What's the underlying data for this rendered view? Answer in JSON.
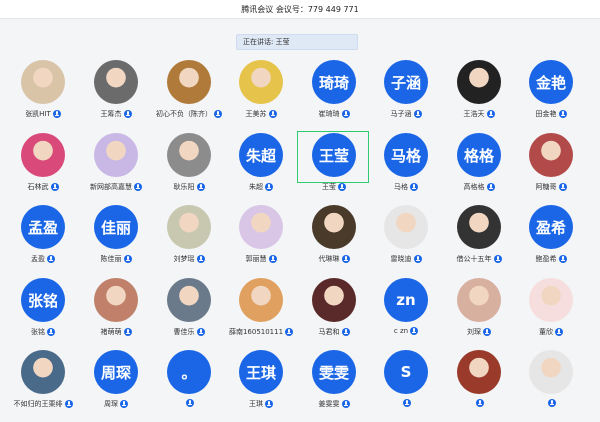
{
  "title": "腾讯会议 会议号：779 449 771",
  "speaking": "正在讲话: 王莹",
  "participants": [
    {
      "name": "张凯HIT",
      "avatar": "photo",
      "avatar_color": "#d9c4a8"
    },
    {
      "name": "王筹杰",
      "avatar": "photo",
      "avatar_color": "#6b6b6b"
    },
    {
      "name": "初心不负（陈齐）",
      "avatar": "photo",
      "avatar_color": "#b07a3b"
    },
    {
      "name": "王美苏",
      "avatar": "photo",
      "avatar_color": "#e6c34a"
    },
    {
      "name": "崔琦琦",
      "avatar": "text",
      "text": "琦琦",
      "avatar_color": "#1a66e6"
    },
    {
      "name": "马子涵",
      "avatar": "text",
      "text": "子涵",
      "avatar_color": "#1a66e6"
    },
    {
      "name": "王浩天",
      "avatar": "photo",
      "avatar_color": "#222222"
    },
    {
      "name": "田金艳",
      "avatar": "text",
      "text": "金艳",
      "avatar_color": "#1a66e6"
    },
    {
      "name": "石林武",
      "avatar": "photo",
      "avatar_color": "#d94a7a"
    },
    {
      "name": "新网部高嘉慧",
      "avatar": "photo",
      "avatar_color": "#c9b7e6"
    },
    {
      "name": "耿乐阳",
      "avatar": "photo",
      "avatar_color": "#8c8c8c"
    },
    {
      "name": "朱超",
      "avatar": "text",
      "text": "朱超",
      "avatar_color": "#1a66e6"
    },
    {
      "name": "王莹",
      "avatar": "text",
      "text": "王莹",
      "avatar_color": "#1a66e6"
    },
    {
      "name": "马格",
      "avatar": "text",
      "text": "马格",
      "avatar_color": "#1a66e6"
    },
    {
      "name": "高格格",
      "avatar": "text",
      "text": "格格",
      "avatar_color": "#1a66e6"
    },
    {
      "name": "阿糖哥",
      "avatar": "photo",
      "avatar_color": "#b34a4a"
    },
    {
      "name": "孟盈",
      "avatar": "text",
      "text": "孟盈",
      "avatar_color": "#1a66e6"
    },
    {
      "name": "陈佳丽",
      "avatar": "text",
      "text": "佳丽",
      "avatar_color": "#1a66e6"
    },
    {
      "name": "刘梦瑶",
      "avatar": "photo",
      "avatar_color": "#c8c8b0"
    },
    {
      "name": "郭丽慧",
      "avatar": "photo",
      "avatar_color": "#d9c6e6"
    },
    {
      "name": "代琳琳",
      "avatar": "photo",
      "avatar_color": "#4a3a2a"
    },
    {
      "name": "雷晓迪",
      "avatar": "photo",
      "avatar_color": "#e6e6e6"
    },
    {
      "name": "借公十五年",
      "avatar": "photo",
      "avatar_color": "#333333"
    },
    {
      "name": "鲍盈希",
      "avatar": "text",
      "text": "盈希",
      "avatar_color": "#1a66e6"
    },
    {
      "name": "张铭",
      "avatar": "text",
      "text": "张铭",
      "avatar_color": "#1a66e6"
    },
    {
      "name": "褚萌萌",
      "avatar": "photo",
      "avatar_color": "#c0806a"
    },
    {
      "name": "曹佳乐",
      "avatar": "photo",
      "avatar_color": "#6a7a8a"
    },
    {
      "name": "薛南160510111",
      "avatar": "photo",
      "avatar_color": "#e0a060"
    },
    {
      "name": "马君和",
      "avatar": "photo",
      "avatar_color": "#5a2a2a"
    },
    {
      "name": "c zn",
      "avatar": "text",
      "text": "zn",
      "avatar_color": "#1a66e6"
    },
    {
      "name": "刘琛",
      "avatar": "photo",
      "avatar_color": "#d8b0a0"
    },
    {
      "name": "董欣",
      "avatar": "photo",
      "avatar_color": "#f6dede"
    },
    {
      "name": "不如归的王栗绯",
      "avatar": "photo",
      "avatar_color": "#4a6a8a"
    },
    {
      "name": "周琛",
      "avatar": "text",
      "text": "周琛",
      "avatar_color": "#1a66e6"
    },
    {
      "name": "",
      "avatar": "text",
      "text": "。",
      "avatar_color": "#1a66e6"
    },
    {
      "name": "王琪",
      "avatar": "text",
      "text": "王琪",
      "avatar_color": "#1a66e6"
    },
    {
      "name": "姜雯雯",
      "avatar": "text",
      "text": "雯雯",
      "avatar_color": "#1a66e6"
    },
    {
      "name": "",
      "avatar": "text",
      "text": "S",
      "avatar_color": "#1a66e6"
    },
    {
      "name": "",
      "avatar": "photo",
      "avatar_color": "#9a3a2a"
    },
    {
      "name": "",
      "avatar": "photo",
      "avatar_color": "#e6e6e6"
    }
  ]
}
